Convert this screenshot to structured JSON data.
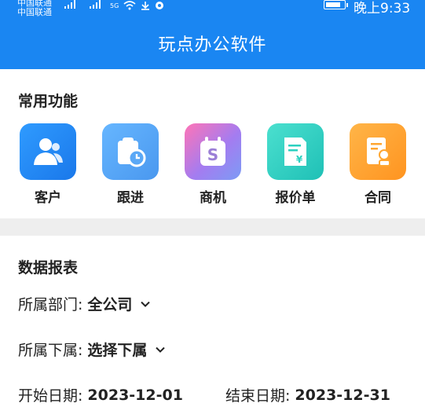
{
  "status_bar": {
    "carrier_line1": "中国联通",
    "carrier_line2": "中国联通",
    "time": "晚上9:33",
    "network_label": "5G"
  },
  "app_bar": {
    "title": "玩点办公软件"
  },
  "common_functions": {
    "title": "常用功能",
    "items": [
      {
        "label": "客户",
        "icon": "customer-icon",
        "color": "#1a86f2"
      },
      {
        "label": "跟进",
        "icon": "follow-up-icon",
        "color": "#5aa8f6"
      },
      {
        "label": "商机",
        "icon": "opportunity-icon",
        "color": "#9b7fd6"
      },
      {
        "label": "报价单",
        "icon": "quote-icon",
        "color": "#2bd1c0"
      },
      {
        "label": "合同",
        "icon": "contract-icon",
        "color": "#ffa630"
      }
    ]
  },
  "reports": {
    "title": "数据报表",
    "department_label": "所属部门:",
    "department_value": "全公司",
    "subordinate_label": "所属下属:",
    "subordinate_value": "选择下属",
    "start_label": "开始日期:",
    "start_value": "2023-12-01",
    "end_label": "结束日期:",
    "end_value": "2023-12-31"
  }
}
